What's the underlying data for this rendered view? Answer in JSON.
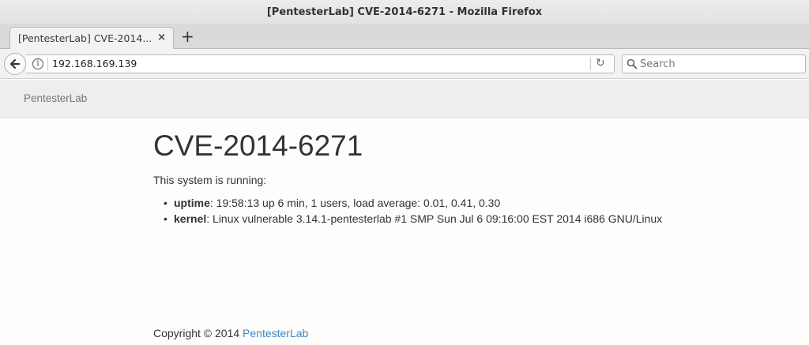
{
  "window": {
    "title": "[PentesterLab] CVE-2014-6271 - Mozilla Firefox"
  },
  "tabs": [
    {
      "label": "[PentesterLab] CVE-2014...",
      "close_glyph": "×"
    }
  ],
  "new_tab_glyph": "+",
  "navbar": {
    "url": "192.168.169.139",
    "info_glyph": "i",
    "reload_glyph": "↻",
    "search_placeholder": "Search"
  },
  "site": {
    "brand": "PentesterLab"
  },
  "main": {
    "title": "CVE-2014-6271",
    "intro": "This system is running:",
    "items": [
      {
        "key": "uptime",
        "value": ": 19:58:13 up 6 min, 1 users, load average: 0.01, 0.41, 0.30"
      },
      {
        "key": "kernel",
        "value": ": Linux vulnerable 3.14.1-pentesterlab #1 SMP Sun Jul 6 09:16:00 EST 2014 i686 GNU/Linux"
      }
    ]
  },
  "footer": {
    "copyright": "Copyright © 2014 ",
    "link": "PentesterLab"
  },
  "colors": {
    "link": "#3b86c8",
    "text": "#333333",
    "header_bg": "#eeeeec"
  },
  "icons": [
    "back-arrow-icon",
    "info-icon",
    "reload-icon",
    "search-icon",
    "close-icon",
    "plus-icon"
  ]
}
